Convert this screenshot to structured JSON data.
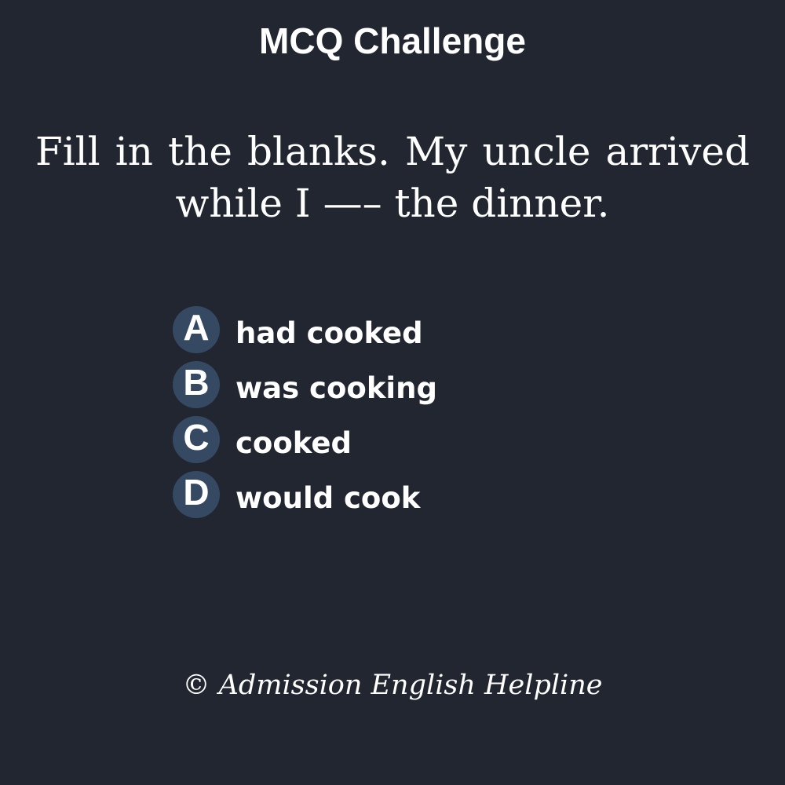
{
  "title": "MCQ Challenge",
  "question": "Fill in the blanks. My uncle arrived while I —– the dinner.",
  "options": [
    {
      "letter": "A",
      "text": "had cooked"
    },
    {
      "letter": "B",
      "text": "was cooking"
    },
    {
      "letter": "C",
      "text": "cooked"
    },
    {
      "letter": "D",
      "text": "would cook"
    }
  ],
  "copyright": "© Admission English Helpline",
  "colors": {
    "background": "#222630",
    "letter_circle": "#354a62",
    "text": "#ffffff"
  }
}
